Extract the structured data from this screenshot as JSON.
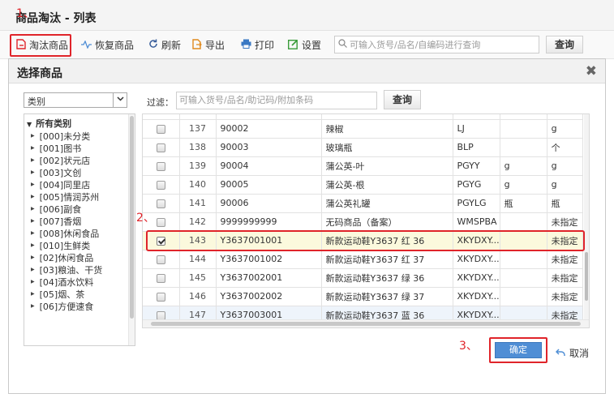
{
  "window": {
    "title": "商品淘汰 - 列表"
  },
  "annotations": {
    "step1": "1、",
    "step2": "2、",
    "step3": "3、"
  },
  "toolbar": {
    "eliminate_label": "淘汰商品",
    "restore_label": "恢复商品",
    "refresh_label": "刷新",
    "export_label": "导出",
    "print_label": "打印",
    "settings_label": "设置",
    "search_placeholder": "可输入货号/品名/自编码进行查询",
    "search_button": "查询"
  },
  "dialog": {
    "title": "选择商品",
    "category_select": "类别",
    "filter_label": "过滤：",
    "filter_placeholder": "可输入货号/品名/助记码/附加条码",
    "filter_button": "查询",
    "tree_root": "所有类别",
    "categories": [
      "[000]未分类",
      "[001]图书",
      "[002]状元店",
      "[003]文创",
      "[004]同里店",
      "[005]情润苏州",
      "[006]副食",
      "[007]香烟",
      "[008]休闲食品",
      "[010]生鲜类",
      "[02]休闲食品",
      "[03]粮油、干货",
      "[04]酒水饮料",
      "[05]烟、茶",
      "[06]方便速食"
    ],
    "rows": [
      {
        "seq": "137",
        "code": "90002",
        "name": "辣椒",
        "mnemonic": "LJ",
        "unit1": "",
        "unit2": "g",
        "checked": false
      },
      {
        "seq": "138",
        "code": "90003",
        "name": "玻璃瓶",
        "mnemonic": "BLP",
        "unit1": "",
        "unit2": "个",
        "checked": false
      },
      {
        "seq": "139",
        "code": "90004",
        "name": "蒲公英-叶",
        "mnemonic": "PGYY",
        "unit1": "g",
        "unit2": "g",
        "checked": false
      },
      {
        "seq": "140",
        "code": "90005",
        "name": "蒲公英-根",
        "mnemonic": "PGYG",
        "unit1": "g",
        "unit2": "g",
        "checked": false
      },
      {
        "seq": "141",
        "code": "90006",
        "name": "蒲公英礼罐",
        "mnemonic": "PGYLG",
        "unit1": "瓶",
        "unit2": "瓶",
        "checked": false
      },
      {
        "seq": "142",
        "code": "9999999999",
        "name": "无码商品（备案）",
        "mnemonic": "WMSPBA",
        "unit1": "",
        "unit2": "未指定",
        "checked": false
      },
      {
        "seq": "143",
        "code": "Y3637001001",
        "name": "新款运动鞋Y3637 红 36",
        "mnemonic": "XKYDXY...",
        "unit1": "",
        "unit2": "未指定",
        "checked": true
      },
      {
        "seq": "144",
        "code": "Y3637001002",
        "name": "新款运动鞋Y3637 红 37",
        "mnemonic": "XKYDXY...",
        "unit1": "",
        "unit2": "未指定",
        "checked": false
      },
      {
        "seq": "145",
        "code": "Y3637002001",
        "name": "新款运动鞋Y3637 绿 36",
        "mnemonic": "XKYDXY...",
        "unit1": "",
        "unit2": "未指定",
        "checked": false
      },
      {
        "seq": "146",
        "code": "Y3637002002",
        "name": "新款运动鞋Y3637 绿 37",
        "mnemonic": "XKYDXY...",
        "unit1": "",
        "unit2": "未指定",
        "checked": false
      },
      {
        "seq": "147",
        "code": "Y3637003001",
        "name": "新款运动鞋Y3637 蓝 36",
        "mnemonic": "XKYDXY...",
        "unit1": "",
        "unit2": "未指定",
        "checked": false
      }
    ],
    "ok_button": "确定",
    "cancel_button": "取消"
  },
  "colors": {
    "accent": "#4f8ed5",
    "highlight": "#e0242a",
    "selected_row": "#fbf9dd"
  }
}
